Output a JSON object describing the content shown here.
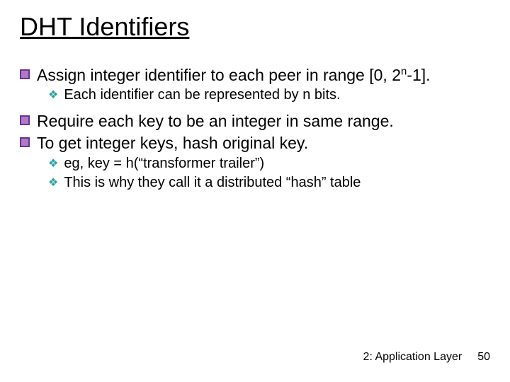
{
  "title": "DHT Identifiers",
  "bullets": {
    "b1_pre": "Assign integer identifier to each peer in range [0, 2",
    "b1_sup": "n",
    "b1_post": "-1].",
    "b1_sub1": "Each identifier can be represented by n bits.",
    "b2": "Require each key to be an integer in same range.",
    "b3": "To get integer keys, hash original key.",
    "b3_sub1": "eg, key = h(“transformer trailer”)",
    "b3_sub2": "This is why they call it a distributed “hash” table"
  },
  "footer": {
    "section": "2: Application Layer",
    "page": "50"
  }
}
